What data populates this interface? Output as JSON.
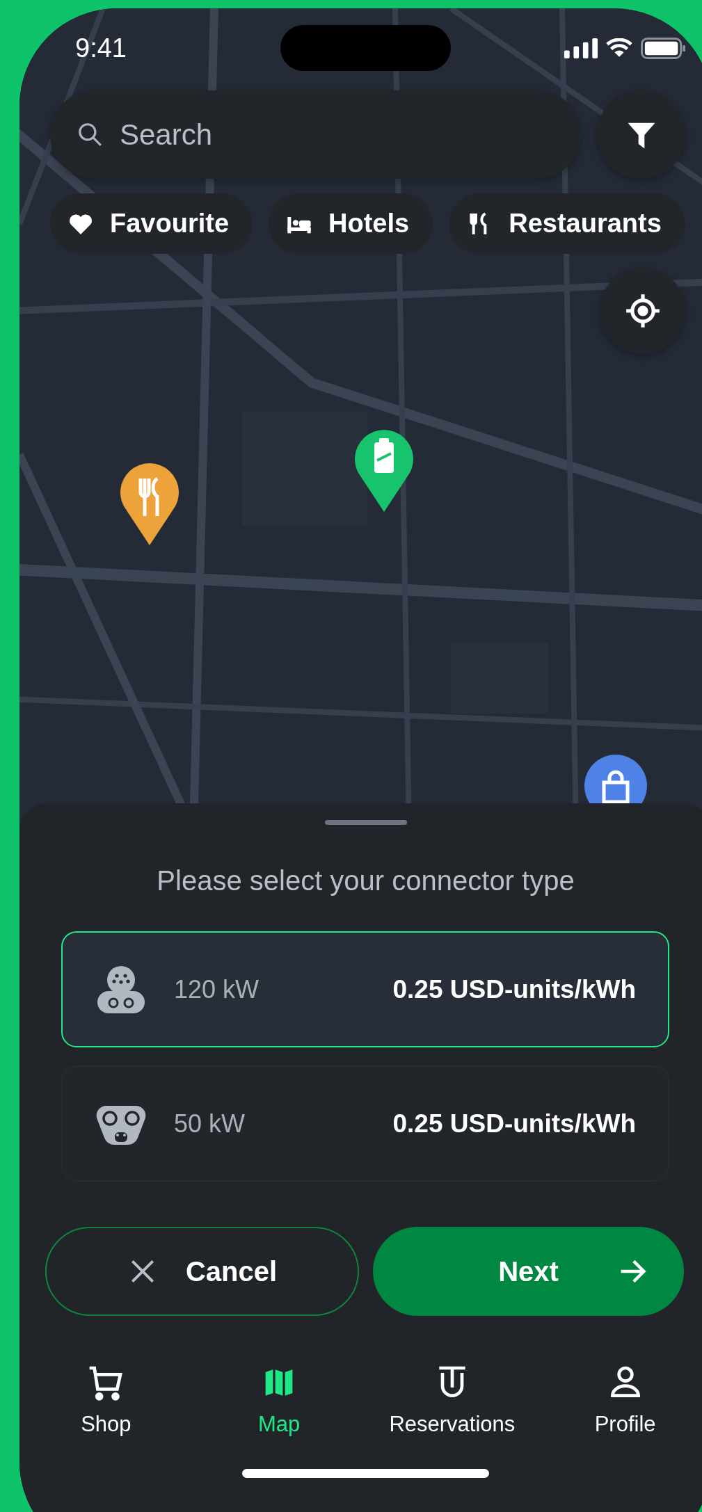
{
  "status_bar": {
    "time": "9:41"
  },
  "search": {
    "placeholder": "Search"
  },
  "filters": [
    {
      "kind": "heart",
      "label": "Favourite"
    },
    {
      "kind": "bed",
      "label": "Hotels"
    },
    {
      "kind": "cutlery",
      "label": "Restaurants"
    }
  ],
  "map": {
    "markers": [
      {
        "kind": "restaurant",
        "color": "#eea23a"
      },
      {
        "kind": "charger",
        "color": "#17c46d"
      },
      {
        "kind": "shop",
        "color": "#4f82e6"
      }
    ]
  },
  "sheet": {
    "title": "Please select your connector type",
    "connectors": [
      {
        "kind": "type2",
        "power": "120 kW",
        "price": "0.25 USD-units/kWh",
        "selected": true
      },
      {
        "kind": "ccs",
        "power": "50 kW",
        "price": "0.25 USD-units/kWh",
        "selected": false
      }
    ]
  },
  "actions": [
    {
      "kind": "cancel",
      "label": "Cancel"
    },
    {
      "kind": "next",
      "label": "Next"
    }
  ],
  "nav": [
    {
      "kind": "cart",
      "label": "Shop",
      "selected": false
    },
    {
      "kind": "map",
      "label": "Map",
      "selected": true
    },
    {
      "kind": "reservation",
      "label": "Reservations",
      "selected": false
    },
    {
      "kind": "person",
      "label": "Profile",
      "selected": false
    }
  ]
}
